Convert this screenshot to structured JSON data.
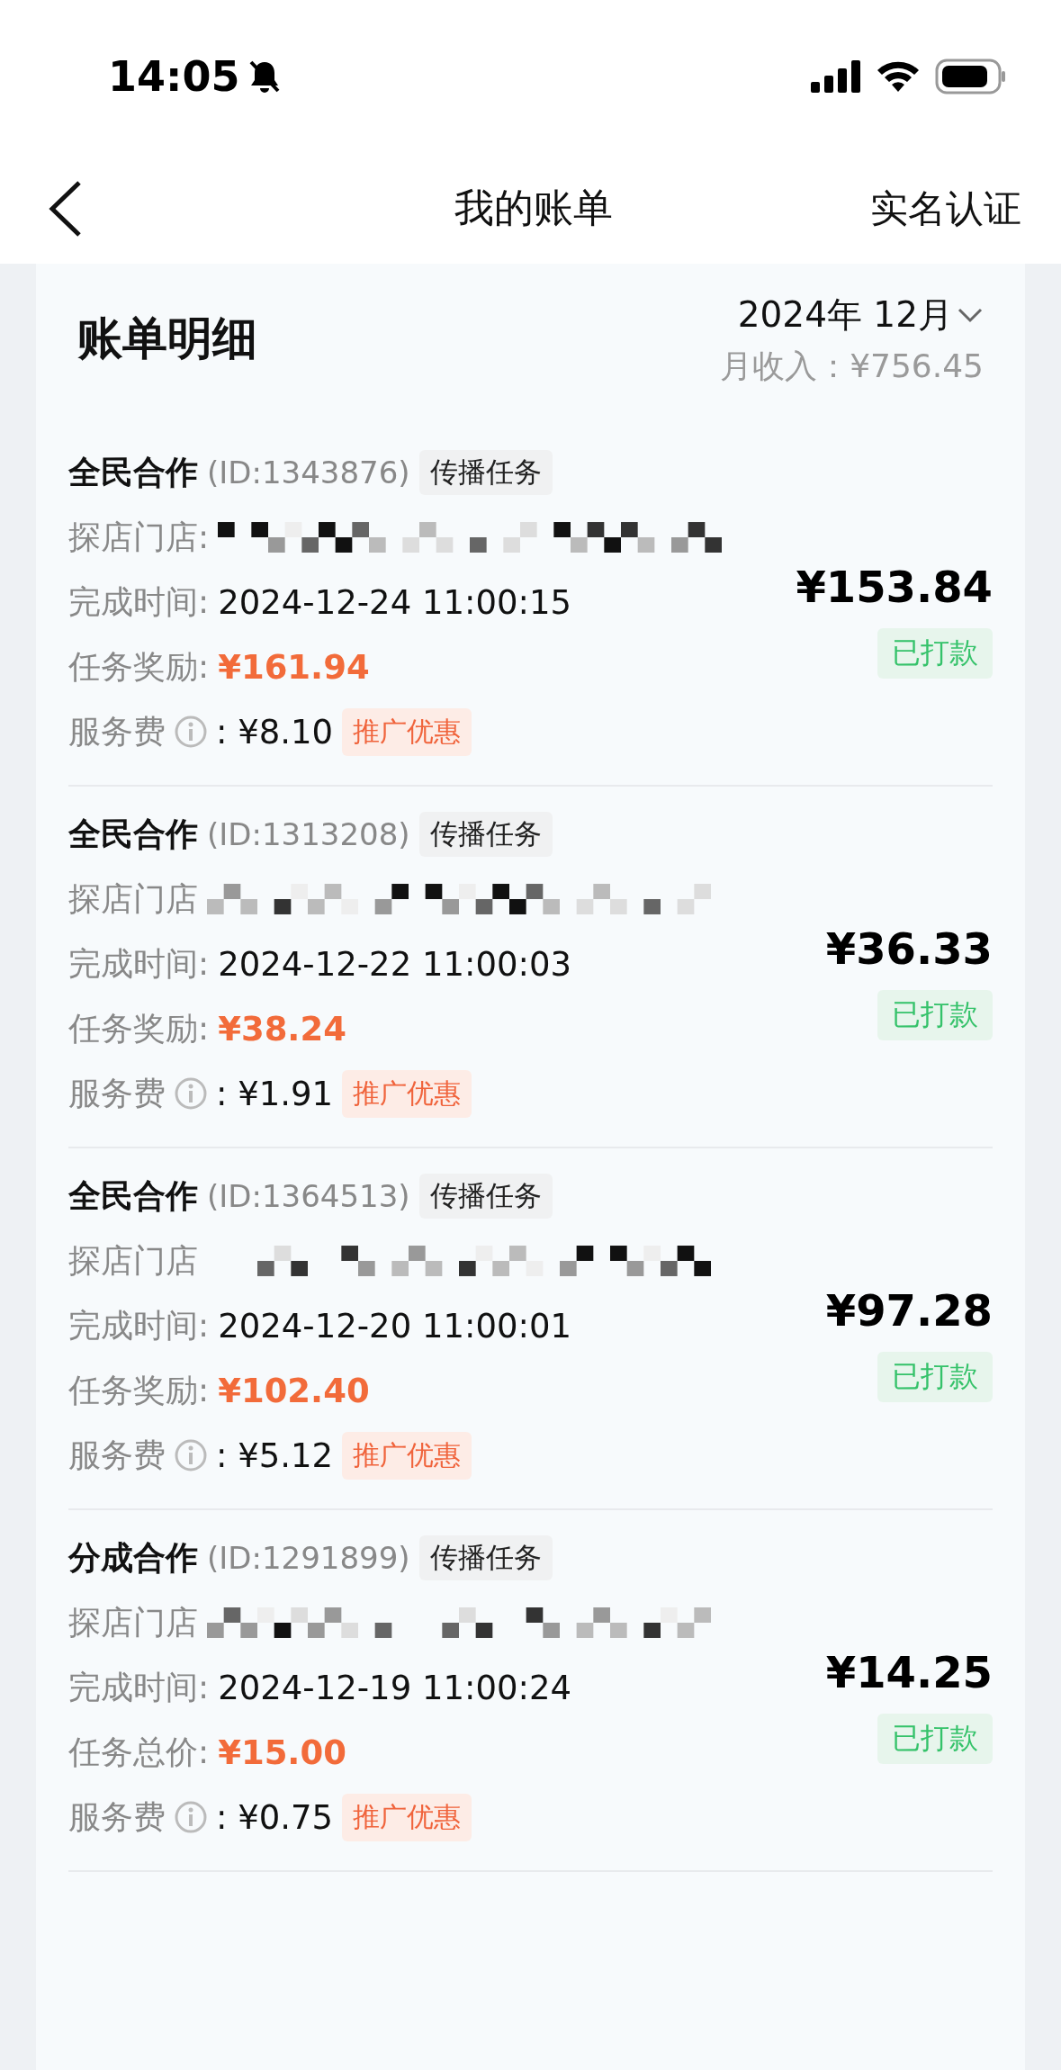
{
  "status_bar": {
    "time": "14:05"
  },
  "nav": {
    "title": "我的账单",
    "action": "实名认证"
  },
  "summary": {
    "title": "账单明细",
    "month": "2024年 12月",
    "income": "月收入：¥756.45"
  },
  "items": [
    {
      "category": "全民合作",
      "id": "(ID:1343876)",
      "tag": "传播任务",
      "store_label": "探店门店:",
      "time_label": "完成时间:",
      "time": "2024-12-24 11:00:15",
      "reward_label": "任务奖励:",
      "reward": "¥161.94",
      "fee_label": "服务费",
      "fee": ": ¥8.10",
      "promo": "推广优惠",
      "amount": "¥153.84",
      "status": "已打款"
    },
    {
      "category": "全民合作",
      "id": "(ID:1313208)",
      "tag": "传播任务",
      "store_label": "探店门店",
      "time_label": "完成时间:",
      "time": "2024-12-22 11:00:03",
      "reward_label": "任务奖励:",
      "reward": "¥38.24",
      "fee_label": "服务费",
      "fee": ": ¥1.91",
      "promo": "推广优惠",
      "amount": "¥36.33",
      "status": "已打款"
    },
    {
      "category": "全民合作",
      "id": "(ID:1364513)",
      "tag": "传播任务",
      "store_label": "探店门店",
      "time_label": "完成时间:",
      "time": "2024-12-20 11:00:01",
      "reward_label": "任务奖励:",
      "reward": "¥102.40",
      "fee_label": "服务费",
      "fee": ": ¥5.12",
      "promo": "推广优惠",
      "amount": "¥97.28",
      "status": "已打款"
    },
    {
      "category": "分成合作",
      "id": "(ID:1291899)",
      "tag": "传播任务",
      "store_label": "探店门店",
      "time_label": "完成时间:",
      "time": "2024-12-19 11:00:24",
      "reward_label": "任务总价:",
      "reward": "¥15.00",
      "fee_label": "服务费",
      "fee": ": ¥0.75",
      "promo": "推广优惠",
      "amount": "¥14.25",
      "status": "已打款"
    }
  ]
}
